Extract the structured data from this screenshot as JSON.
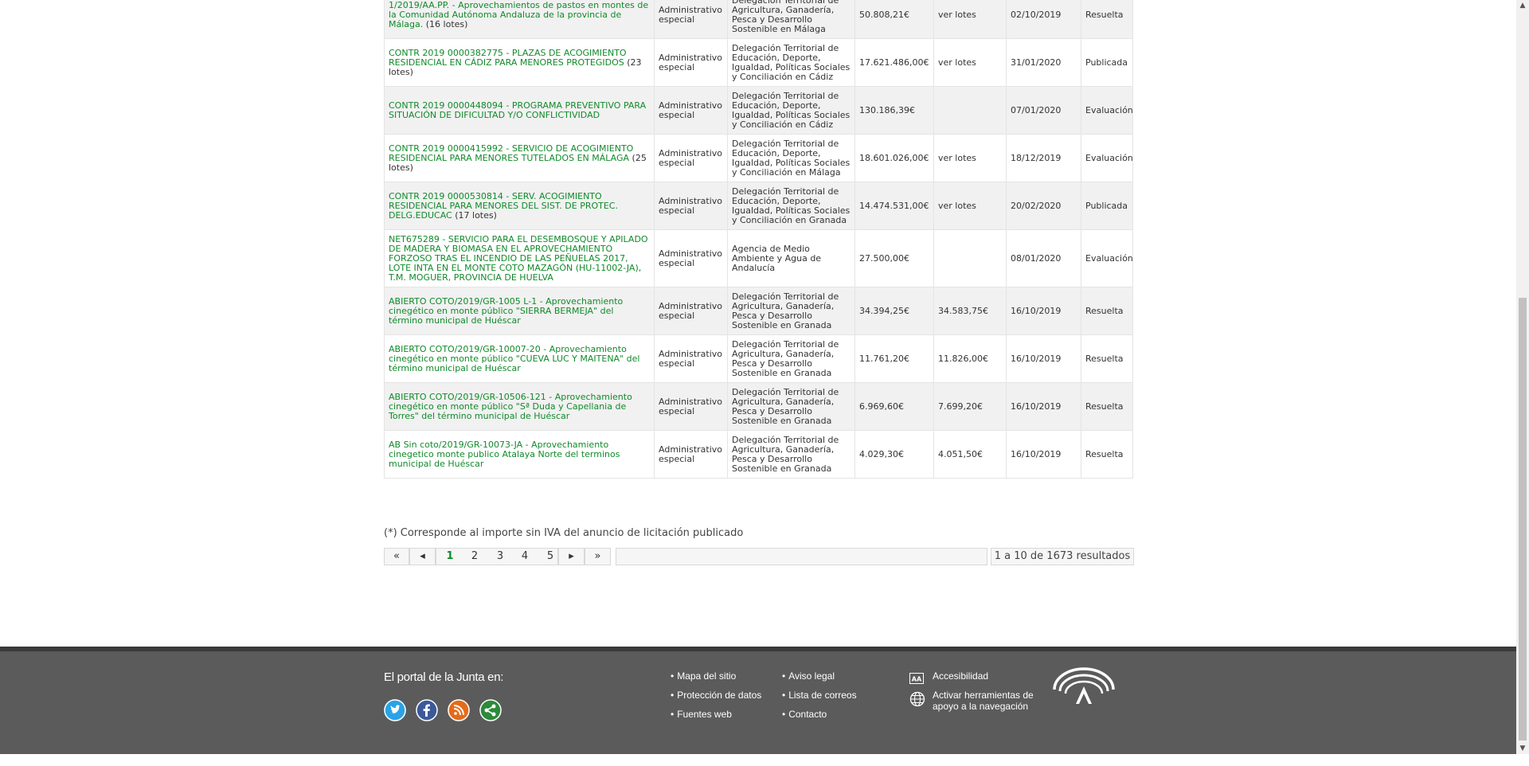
{
  "results": [
    {
      "title": "1/2019/AA.PP. - Aprovechamientos de pastos en montes de la Comunidad Autónoma Andaluza de la provincia de Málaga.",
      "suffix": " (16 lotes)",
      "type": "Administrativo especial",
      "organ": "Delegación Territorial de Agricultura, Ganadería, Pesca y Desarrollo Sostenible en Málaga",
      "amount": "50.808,21€",
      "adj": "ver lotes",
      "date": "02/10/2019",
      "status": "Resuelta"
    },
    {
      "title": "CONTR 2019 0000382775 - PLAZAS DE ACOGIMIENTO RESIDENCIAL EN CÁDIZ PARA MENORES PROTEGIDOS",
      "suffix": " (23 lotes)",
      "type": "Administrativo especial",
      "organ": "Delegación Territorial de Educación, Deporte, Igualdad, Políticas Sociales y Conciliación en Cádiz",
      "amount": "17.621.486,00€",
      "adj": "ver lotes",
      "date": "31/01/2020",
      "status": "Publicada"
    },
    {
      "title": "CONTR 2019 0000448094 - PROGRAMA PREVENTIVO PARA SITUACIÓN DE DIFICULTAD Y/O CONFLICTIVIDAD",
      "suffix": "",
      "type": "Administrativo especial",
      "organ": "Delegación Territorial de Educación, Deporte, Igualdad, Políticas Sociales y Conciliación en Cádiz",
      "amount": "130.186,39€",
      "adj": "",
      "date": "07/01/2020",
      "status": "Evaluación"
    },
    {
      "title": "CONTR 2019 0000415992 - SERVICIO DE ACOGIMIENTO RESIDENCIAL PARA MENORES TUTELADOS EN MÁLAGA",
      "suffix": " (25 lotes)",
      "type": "Administrativo especial",
      "organ": "Delegación Territorial de Educación, Deporte, Igualdad, Políticas Sociales y Conciliación en Málaga",
      "amount": "18.601.026,00€",
      "adj": "ver lotes",
      "date": "18/12/2019",
      "status": "Evaluación"
    },
    {
      "title": "CONTR 2019 0000530814 - SERV. ACOGIMIENTO RESIDENCIAL PARA MENORES DEL SIST. DE PROTEC. DELG.EDUCAC",
      "suffix": " (17 lotes)",
      "type": "Administrativo especial",
      "organ": "Delegación Territorial de Educación, Deporte, Igualdad, Políticas Sociales y Conciliación en Granada",
      "amount": "14.474.531,00€",
      "adj": "ver lotes",
      "date": "20/02/2020",
      "status": "Publicada"
    },
    {
      "title": "NET675289 - SERVICIO PARA EL DESEMBOSQUE Y APILADO DE MADERA Y BIOMASA EN EL APROVECHAMIENTO FORZOSO TRAS EL INCENDIO DE LAS PEÑUELAS 2017, LOTE INTA EN EL MONTE COTO MAZAGÓN (HU-11002-JA), T.M. MOGUER, PROVINCIA DE HUELVA",
      "suffix": "",
      "type": "Administrativo especial",
      "organ": "Agencia de Medio Ambiente y Agua de Andalucía",
      "amount": "27.500,00€",
      "adj": "",
      "date": "08/01/2020",
      "status": "Evaluación"
    },
    {
      "title": "ABIERTO COTO/2019/GR-1005 L-1 - Aprovechamiento cinegético en monte público \"SIERRA BERMEJA\" del término municipal de Huéscar",
      "suffix": "",
      "type": "Administrativo especial",
      "organ": "Delegación Territorial de Agricultura, Ganadería, Pesca y Desarrollo Sostenible en Granada",
      "amount": "34.394,25€",
      "adj": "34.583,75€",
      "date": "16/10/2019",
      "status": "Resuelta"
    },
    {
      "title": "ABIERTO COTO/2019/GR-10007-20 - Aprovechamiento cinegético en monte público \"CUEVA LUC Y MAITENA\" del término municipal de Huéscar",
      "suffix": "",
      "type": "Administrativo especial",
      "organ": "Delegación Territorial de Agricultura, Ganadería, Pesca y Desarrollo Sostenible en Granada",
      "amount": "11.761,20€",
      "adj": "11.826,00€",
      "date": "16/10/2019",
      "status": "Resuelta"
    },
    {
      "title": "ABIERTO COTO/2019/GR-10506-121 - Aprovechamiento cinegético en monte público \"Sª Duda y Capellania de Torres\" del término municipal de Huéscar",
      "suffix": "",
      "type": "Administrativo especial",
      "organ": "Delegación Territorial de Agricultura, Ganadería, Pesca y Desarrollo Sostenible en Granada",
      "amount": "6.969,60€",
      "adj": "7.699,20€",
      "date": "16/10/2019",
      "status": "Resuelta"
    },
    {
      "title": "AB Sin coto/2019/GR-10073-JA - Aprovechamiento cinegetico monte publico Atalaya Norte del terminos municipal de Huéscar",
      "suffix": "",
      "type": "Administrativo especial",
      "organ": "Delegación Territorial de Agricultura, Ganadería, Pesca y Desarrollo Sostenible en Granada",
      "amount": "4.029,30€",
      "adj": "4.051,50€",
      "date": "16/10/2019",
      "status": "Resuelta"
    }
  ],
  "note": "(*) Corresponde al importe sin IVA del anuncio de licitación publicado",
  "pagination": {
    "pages": [
      "1",
      "2",
      "3",
      "4",
      "5"
    ],
    "current": "1",
    "first": "«",
    "prev": "◂",
    "next": "▸",
    "last": "»",
    "count_text": "1 a 10 de 1673 resultados"
  },
  "footer": {
    "title": "El portal de la Junta en:",
    "social": [
      "twitter-icon",
      "facebook-icon",
      "rss-icon",
      "share-icon"
    ],
    "links_col1": [
      "Mapa del sitio",
      "Protección de datos",
      "Fuentes web"
    ],
    "links_col2": [
      "Aviso legal",
      "Lista de correos",
      "Contacto"
    ],
    "accessibility": "Accesibilidad",
    "nav_tools": "Activar herramientas de apoyo a la navegación"
  },
  "colors": {
    "link_green": "#118a2a",
    "footer_bg": "#5b5b5b",
    "row_alt": "#f1f1f1"
  }
}
